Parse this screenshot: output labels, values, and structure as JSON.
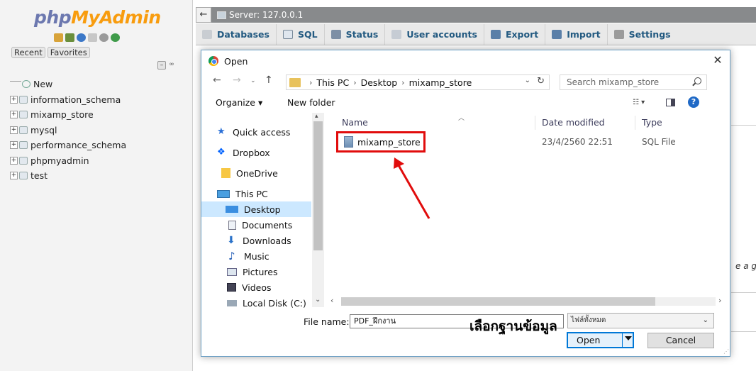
{
  "sidebar": {
    "logo_part1": "php",
    "logo_part2": "MyAdmin",
    "recent_tab": "Recent",
    "favorites_tab": "Favorites",
    "new_label": "New",
    "databases": [
      "information_schema",
      "mixamp_store",
      "mysql",
      "performance_schema",
      "phpmyadmin",
      "test"
    ]
  },
  "server_bar": {
    "title": "Server: 127.0.0.1"
  },
  "menu": {
    "databases": "Databases",
    "sql": "SQL",
    "status": "Status",
    "user_accounts": "User accounts",
    "export": "Export",
    "import": "Import",
    "settings": "Settings"
  },
  "background": {
    "cut_text": "e a go"
  },
  "dialog": {
    "title": "Open",
    "path": [
      "This PC",
      "Desktop",
      "mixamp_store"
    ],
    "search_placeholder": "Search mixamp_store",
    "organize": "Organize ▾",
    "new_folder": "New folder",
    "nav_items": [
      "Quick access",
      "Dropbox",
      "OneDrive",
      "This PC",
      "Desktop",
      "Documents",
      "Downloads",
      "Music",
      "Pictures",
      "Videos",
      "Local Disk (C:)"
    ],
    "selected_nav": "Desktop",
    "columns": {
      "name": "Name",
      "date_modified": "Date modified",
      "type": "Type"
    },
    "file": {
      "name": "mixamp_store",
      "date": "23/4/2560 22:51",
      "type": "SQL File"
    },
    "file_name_label": "File name:",
    "file_name_value": "PDF_ฝึกงาน",
    "file_type_value": "ไฟล์ทั้งหมด",
    "open_button": "Open",
    "cancel_button": "Cancel"
  },
  "annotation": {
    "caption": "เลือกฐานข้อมูล",
    "color": "#e10c0c"
  }
}
